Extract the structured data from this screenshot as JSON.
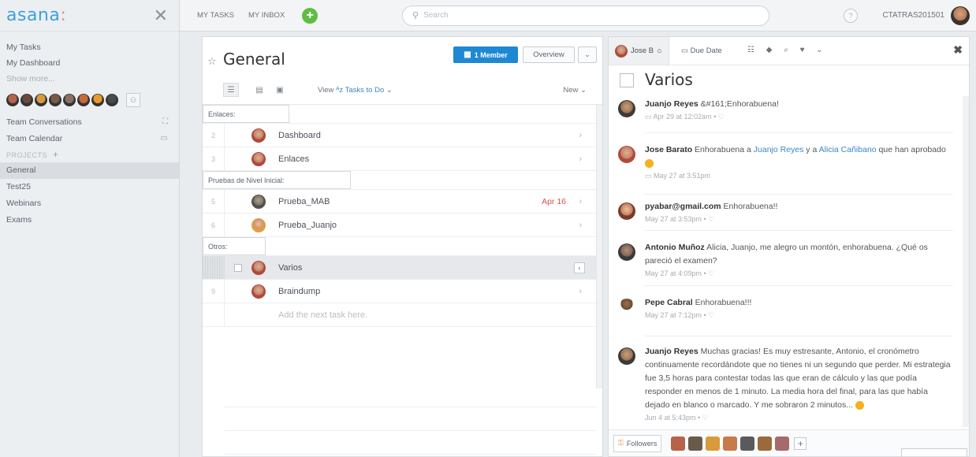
{
  "app": {
    "logo": "asana",
    "logo_dot": ":",
    "close_glyph": "✕"
  },
  "sidebar": {
    "links": [
      "My Tasks",
      "My Dashboard"
    ],
    "show_more": "Show more...",
    "rows": [
      {
        "label": "Team Conversations",
        "icon": "conversations-icon",
        "glyph": "⛶"
      },
      {
        "label": "Team Calendar",
        "icon": "calendar-icon",
        "glyph": "▭"
      }
    ],
    "projects_label": "PROJECTS",
    "projects_plus": "+",
    "projects": [
      "General",
      "Test25",
      "Webinars",
      "Exams"
    ],
    "active_project": "General",
    "member_avatar_colors": [
      "#b5634a",
      "#6a4a3a",
      "#d89a3c",
      "#7a5a4a",
      "#8a7060",
      "#c76a3a",
      "#e89a2a",
      "#4a4a4a"
    ],
    "members_btn_glyph": "⚇"
  },
  "topbar": {
    "my_tasks": "MY TASKS",
    "my_inbox": "MY INBOX",
    "add_glyph": "+",
    "search_placeholder": "Search",
    "help_glyph": "?",
    "user": "CTATRAS201501"
  },
  "tasks": {
    "title": "General",
    "star": "☆",
    "member_button": "1 Member",
    "overview_button": "Overview",
    "caret": "⌄",
    "view_prefix": "View",
    "view_value": "Tasks to Do",
    "view_az": "ᴬz",
    "new_label": "New",
    "sections": [
      {
        "label": "Enlaces:",
        "tasks": [
          {
            "num": "2",
            "name": "Dashboard",
            "due": ""
          },
          {
            "num": "3",
            "name": "Enlaces",
            "due": ""
          }
        ]
      },
      {
        "label": "Pruebas de Nivel Inicial:",
        "tasks": [
          {
            "num": "5",
            "name": "Prueba_MAB",
            "due": "Apr 16"
          },
          {
            "num": "6",
            "name": "Prueba_Juanjo",
            "due": ""
          }
        ]
      },
      {
        "label": "Otros:",
        "tasks": [
          {
            "num": "",
            "name": "Varios",
            "due": ""
          },
          {
            "num": "9",
            "name": "Braindump",
            "due": ""
          }
        ]
      }
    ],
    "add_next": "Add the next task here.",
    "chevron": "›",
    "collapse": "‹"
  },
  "detail": {
    "assignee": "Jose B",
    "due_label": "Due Date",
    "toolbar_icons": "☷ ◆ ⌕ ♥ ⌄",
    "close": "✖",
    "title": "Varios",
    "comments": [
      {
        "author": "Juanjo Reyes",
        "text": " &#161;Enhorabuena!",
        "meta": "Apr 29 at 12:02am • ♡"
      },
      {
        "author": "Jose Barato",
        "text": " Enhorabuena a ",
        "link1": "Juanjo Reyes",
        "mid": " y a ",
        "link2": "Alicia Cañibano",
        "tail": " que han aprobado",
        "meta": "May 27 at 3:51pm"
      },
      {
        "author": "pyabar@gmail.com",
        "text": " Enhorabuena!!",
        "meta": "May 27 at 3:53pm • ♡"
      },
      {
        "author": "Antonio Muñoz",
        "text": " Alicia, Juanjo, me alegro un montón, enhorabuena. ¿Qué os pareció el examen?",
        "meta": "May 27 at 4:09pm • ♡"
      },
      {
        "author": "Pepe Cabral",
        "text": " Enhorabuena!!!",
        "meta": "May 27 at 7:12pm • ♡"
      },
      {
        "author": "Juanjo Reyes",
        "text": " Muchas gracias! Es muy estresante, Antonio, el cronómetro continuamente recordándote que no tienes ni un segundo que perder. Mi estrategia fue 3,5 horas para contestar todas las que eran de cálculo y las que podía responder en menos de 1 minuto. La media hora del final, para las que había dejado en blanco o marcado. Y me sobraron 2 minutos...",
        "meta": "Jun 4 at 5:43pm • ♡"
      }
    ],
    "followers_label": "Followers",
    "followers_rss": "⚿",
    "follower_colors": [
      "#b5634a",
      "#6a5a4a",
      "#d89a3c",
      "#c77a4a",
      "#5a5a5a",
      "#9a6a3a",
      "#a56a6a"
    ],
    "add_follower": "+"
  }
}
